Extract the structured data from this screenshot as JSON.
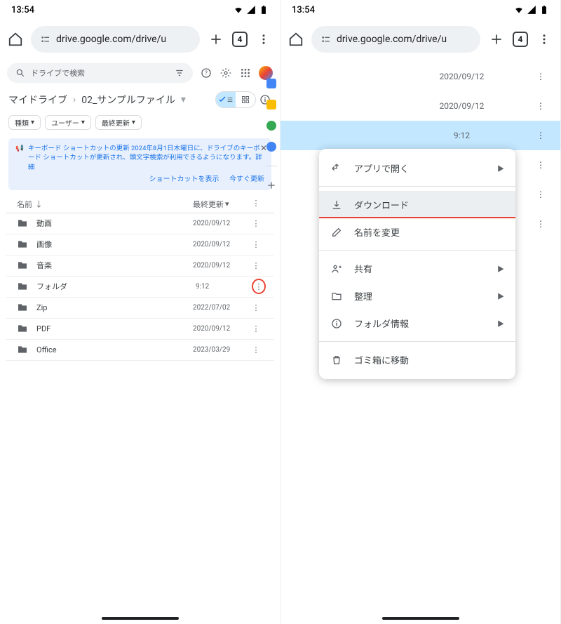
{
  "status": {
    "time": "13:54"
  },
  "browser": {
    "url": "drive.google.com/drive/u",
    "tab_count": "4"
  },
  "search": {
    "placeholder": "ドライブで検索"
  },
  "breadcrumb": {
    "root": "マイドライブ",
    "current": "02_サンプルファイル"
  },
  "filters": {
    "type": "種類",
    "user": "ユーザー",
    "modified": "最終更新"
  },
  "banner": {
    "text": "キーボード ショートカットの更新 2024年8月1日木曜日に、ドライブのキーボード ショートカットが更新され、頭文字検索が利用できるようになります。詳細",
    "action1": "ショートカットを表示",
    "action2": "今すぐ更新"
  },
  "columns": {
    "name": "名前",
    "date": "最終更新"
  },
  "files": [
    {
      "name": "動画",
      "date": "2020/09/12"
    },
    {
      "name": "画像",
      "date": "2020/09/12"
    },
    {
      "name": "音楽",
      "date": "2020/09/12"
    },
    {
      "name": "フォルダ",
      "date": "9:12"
    },
    {
      "name": "Zip",
      "date": "2022/07/02"
    },
    {
      "name": "PDF",
      "date": "2020/09/12"
    },
    {
      "name": "Office",
      "date": "2023/03/29"
    }
  ],
  "p2_rows": [
    {
      "date": "2020/09/12"
    },
    {
      "date": "2020/09/12"
    },
    {
      "date": "9:12"
    },
    {
      "date": ""
    },
    {
      "date": ""
    }
  ],
  "menu": {
    "open_with": "アプリで開く",
    "download": "ダウンロード",
    "rename": "名前を変更",
    "share": "共有",
    "organize": "整理",
    "info": "フォルダ情報",
    "trash": "ゴミ箱に移動"
  }
}
